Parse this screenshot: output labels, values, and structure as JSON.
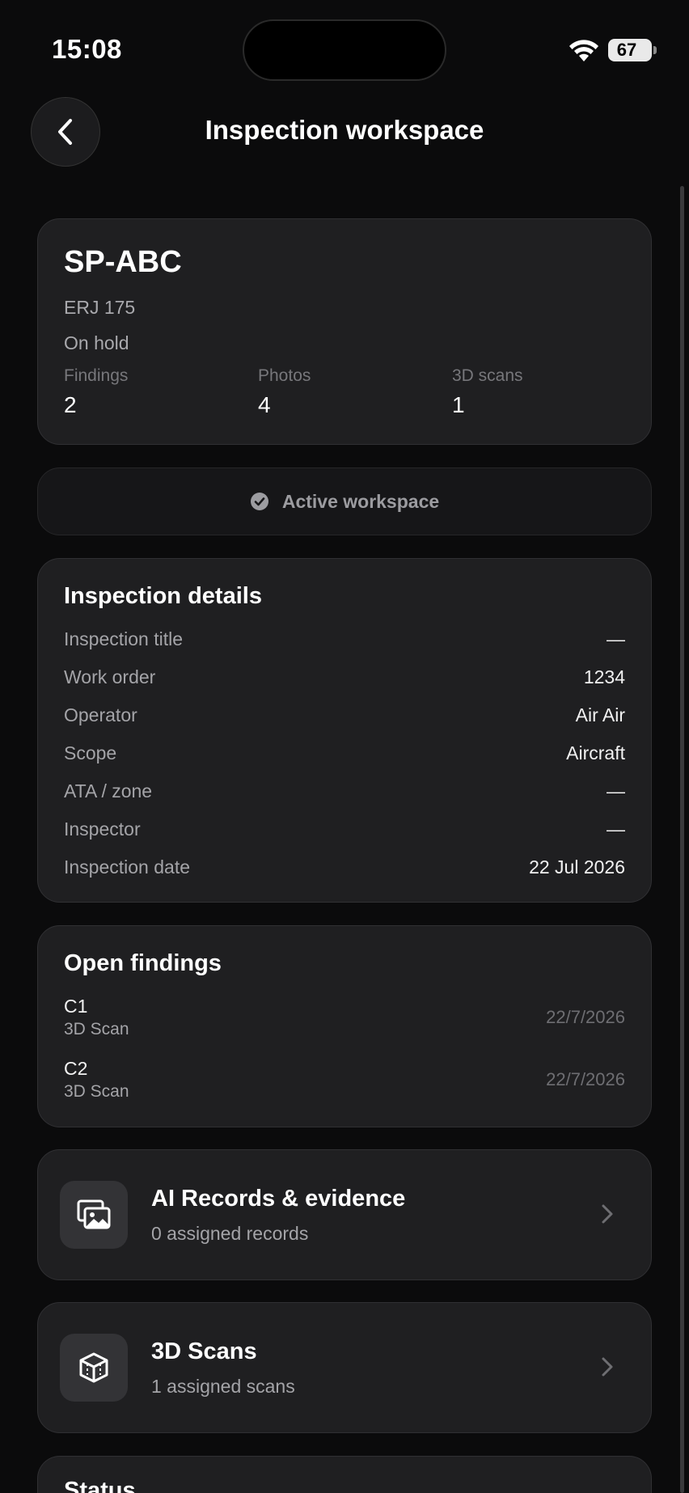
{
  "status_bar": {
    "time": "15:08",
    "battery": "67"
  },
  "header": {
    "title": "Inspection workspace"
  },
  "aircraft": {
    "registration": "SP-ABC",
    "model": "ERJ 175",
    "status": "On hold",
    "stats": [
      {
        "label": "Findings",
        "value": "2"
      },
      {
        "label": "Photos",
        "value": "4"
      },
      {
        "label": "3D scans",
        "value": "1"
      }
    ]
  },
  "workspace": {
    "label": "Active workspace"
  },
  "details": {
    "title": "Inspection details",
    "rows": [
      {
        "label": "Inspection title",
        "value": "—"
      },
      {
        "label": "Work order",
        "value": "1234"
      },
      {
        "label": "Operator",
        "value": "Air Air"
      },
      {
        "label": "Scope",
        "value": "Aircraft"
      },
      {
        "label": "ATA / zone",
        "value": "—"
      },
      {
        "label": "Inspector",
        "value": "—"
      },
      {
        "label": "Inspection date",
        "value": "22 Jul 2026"
      }
    ]
  },
  "findings": {
    "title": "Open findings",
    "items": [
      {
        "code": "C1",
        "type": "3D Scan",
        "date": "22/7/2026"
      },
      {
        "code": "C2",
        "type": "3D Scan",
        "date": "22/7/2026"
      }
    ]
  },
  "records_card": {
    "title": "AI Records & evidence",
    "subtitle": "0 assigned records",
    "icon": "photo-gallery-icon"
  },
  "scans_card": {
    "title": "3D Scans",
    "subtitle": "1 assigned scans",
    "icon": "cube-icon"
  },
  "status_section": {
    "title": "Status"
  },
  "colors": {
    "background": "#0b0b0c",
    "card": "#1f1f21",
    "card_border": "#303033",
    "muted_text": "#a4a4a8"
  }
}
